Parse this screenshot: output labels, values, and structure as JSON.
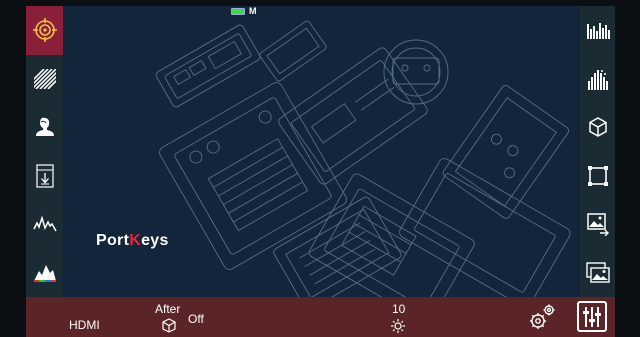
{
  "status": {
    "mode_indicator": "M"
  },
  "brand": {
    "logo_prefix": "Port",
    "logo_k": "K",
    "logo_suffix": "eys"
  },
  "bottom_bar": {
    "input_label": "HDMI",
    "mode_top": "After",
    "mode_value": "Off",
    "brightness_value": "10"
  },
  "left_tools": [
    {
      "name": "focus-assist-button",
      "icon": "target-icon",
      "active": true
    },
    {
      "name": "zebra-button",
      "icon": "zebra-stripes-icon",
      "active": false
    },
    {
      "name": "skin-tone-button",
      "icon": "person-silhouette-icon",
      "active": false
    },
    {
      "name": "false-color-button",
      "icon": "exposure-scale-icon",
      "active": false
    },
    {
      "name": "waveform-button",
      "icon": "waveform-icon",
      "active": false
    },
    {
      "name": "histogram-button",
      "icon": "histogram-icon",
      "active": false
    }
  ],
  "right_tools": [
    {
      "name": "audio-meter-button",
      "icon": "level-bars-icon"
    },
    {
      "name": "vectorscope-button",
      "icon": "gradient-bars-icon"
    },
    {
      "name": "lut-button",
      "icon": "cube-icon"
    },
    {
      "name": "frame-guide-button",
      "icon": "frame-corners-icon"
    },
    {
      "name": "image-export-button",
      "icon": "image-arrow-icon"
    },
    {
      "name": "image-compare-button",
      "icon": "image-stack-icon"
    }
  ],
  "colors": {
    "accent_active": "#8a1f3a",
    "toolbar_bg": "#1b2b33",
    "bottom_bar_bg": "#5b2426",
    "viewport_bg": "#13253a",
    "battery": "#3ddc3d",
    "logo_k": "#e0263a"
  }
}
